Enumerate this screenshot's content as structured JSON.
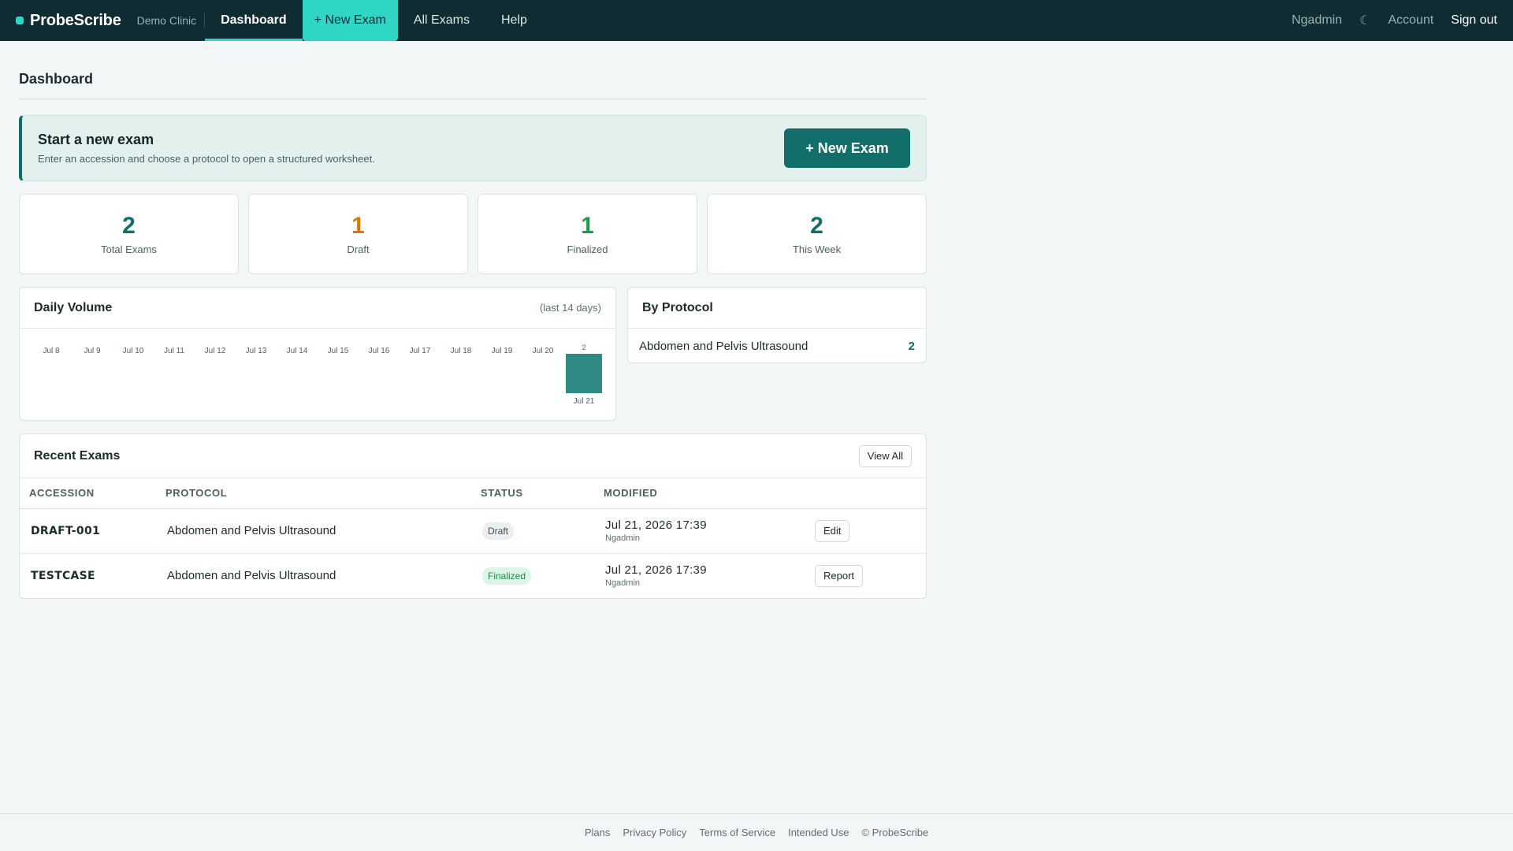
{
  "nav": {
    "brand": "ProbeScribe",
    "clinic": "Demo Clinic",
    "items": [
      {
        "label": "Dashboard"
      },
      {
        "label": "+ New Exam"
      },
      {
        "label": "All Exams"
      },
      {
        "label": "Help"
      }
    ],
    "user": "Ngadmin",
    "theme_icon": "☾",
    "account": "Account",
    "signout": "Sign out"
  },
  "page": {
    "title": "Dashboard"
  },
  "hero": {
    "title": "Start a new exam",
    "subtitle": "Enter an accession and choose a protocol to open a structured worksheet.",
    "button": "+ New Exam"
  },
  "stats": [
    {
      "value": "2",
      "label": "Total Exams",
      "color": "#126e69"
    },
    {
      "value": "1",
      "label": "Draft",
      "color": "#d97706"
    },
    {
      "value": "1",
      "label": "Finalized",
      "color": "#1d9a4b"
    },
    {
      "value": "2",
      "label": "This Week",
      "color": "#126e69"
    }
  ],
  "daily_volume": {
    "title": "Daily Volume",
    "note": "(last 14 days)"
  },
  "chart_data": {
    "type": "bar",
    "categories": [
      "Jul 8",
      "Jul 9",
      "Jul 10",
      "Jul 11",
      "Jul 12",
      "Jul 13",
      "Jul 14",
      "Jul 15",
      "Jul 16",
      "Jul 17",
      "Jul 18",
      "Jul 19",
      "Jul 20",
      "Jul 21"
    ],
    "values": [
      0,
      0,
      0,
      0,
      0,
      0,
      0,
      0,
      0,
      0,
      0,
      0,
      0,
      2
    ],
    "title": "Daily Volume",
    "xlabel": "",
    "ylabel": "",
    "ylim": [
      0,
      2
    ],
    "grid": false,
    "bar_color": "#2f8a84"
  },
  "by_protocol": {
    "title": "By Protocol",
    "rows": [
      {
        "name": "Abdomen and Pelvis Ultrasound",
        "count": "2"
      }
    ]
  },
  "recent": {
    "title": "Recent Exams",
    "view_all": "View All",
    "columns": [
      "ACCESSION",
      "PROTOCOL",
      "STATUS",
      "MODIFIED",
      ""
    ],
    "rows": [
      {
        "accession": "DRAFT-001",
        "protocol": "Abdomen and Pelvis Ultrasound",
        "status": "Draft",
        "modified": "Jul 21, 2026 17:39",
        "user": "Ngadmin",
        "action": "Edit"
      },
      {
        "accession": "TESTCASE",
        "protocol": "Abdomen and Pelvis Ultrasound",
        "status": "Finalized",
        "modified": "Jul 21, 2026 17:39",
        "user": "Ngadmin",
        "action": "Report"
      }
    ]
  },
  "footer": {
    "links": [
      "Plans",
      "Privacy Policy",
      "Terms of Service",
      "Intended Use",
      "© ProbeScribe"
    ]
  }
}
